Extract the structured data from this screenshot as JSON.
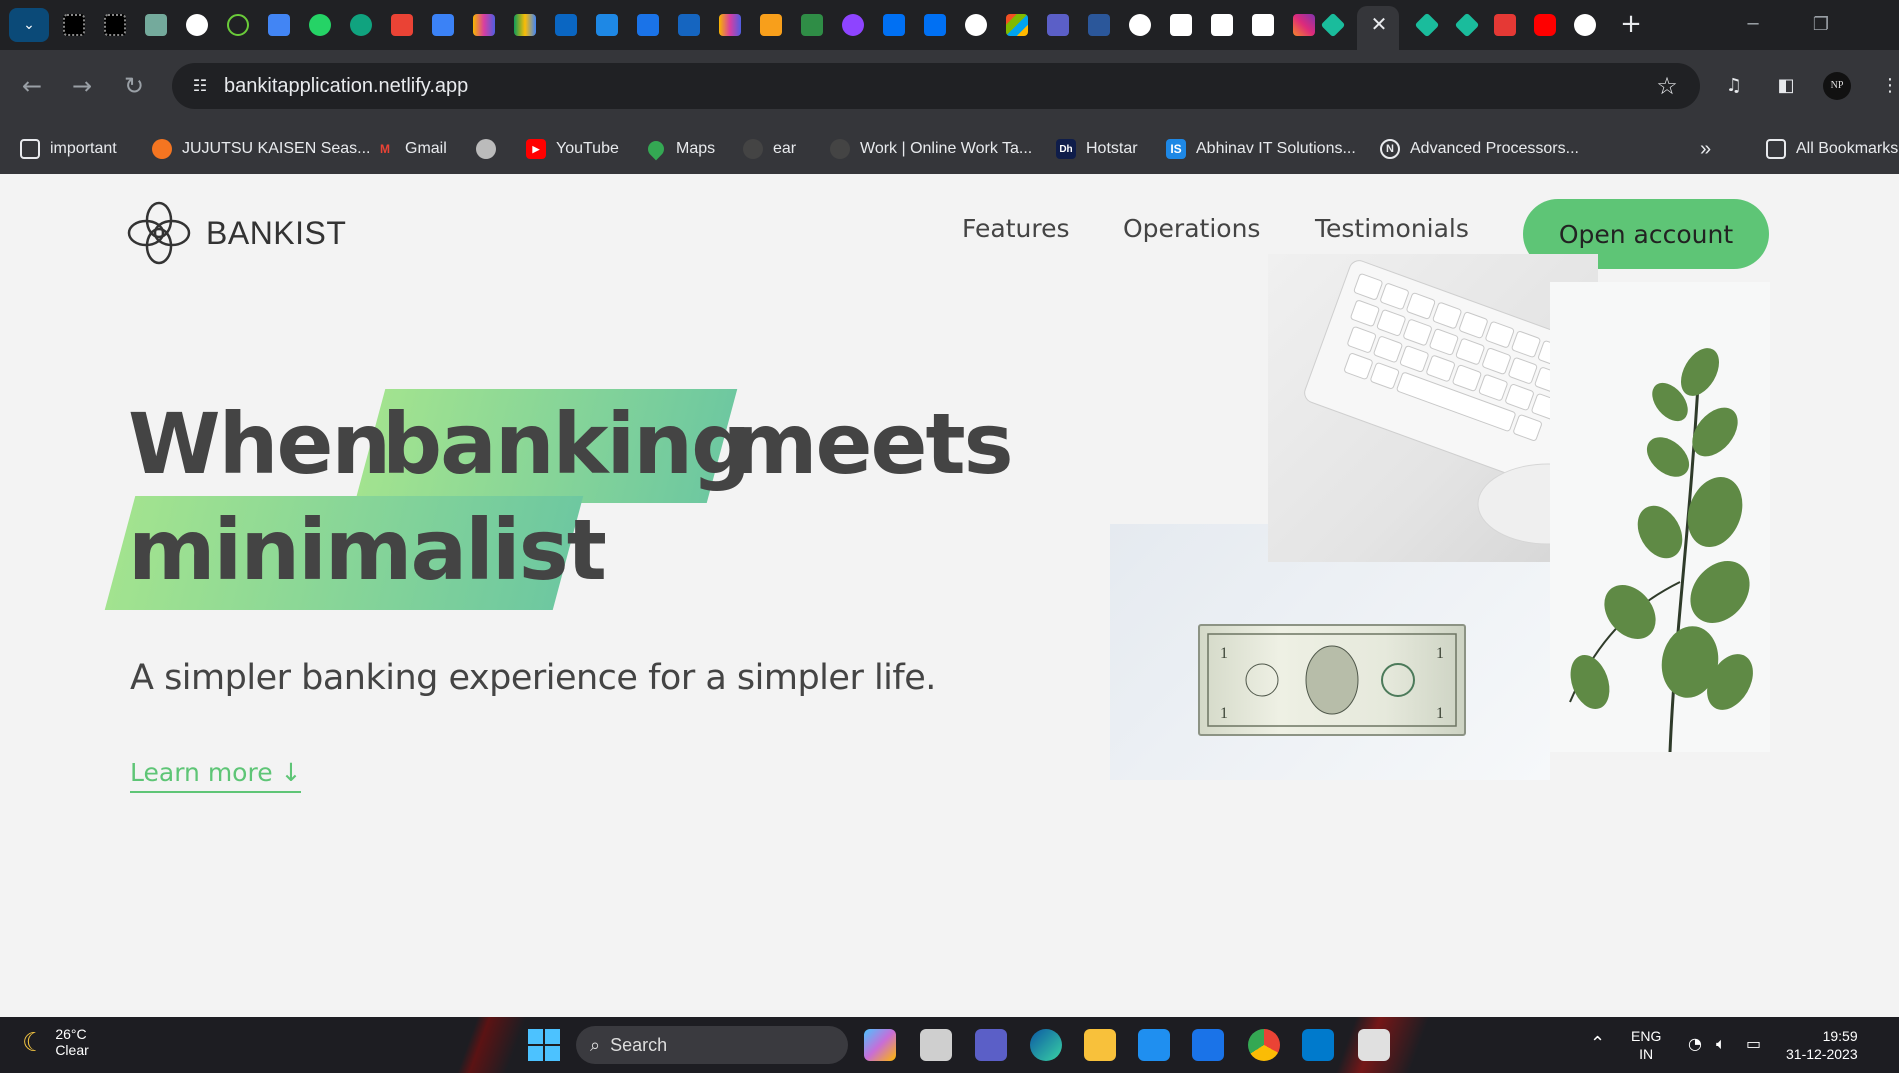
{
  "browser": {
    "url": "bankitapplication.netlify.app",
    "active_tab_close": "✕",
    "new_tab": "+",
    "bookmarks": [
      {
        "label": "important",
        "icon": "folder-icon"
      },
      {
        "label": "JUJUTSU KAISEN Seas...",
        "icon": "crunchyroll-icon"
      },
      {
        "label": "Gmail",
        "icon": "gmail-icon"
      },
      {
        "label": "",
        "icon": "globe-icon"
      },
      {
        "label": "YouTube",
        "icon": "youtube-icon"
      },
      {
        "label": "Maps",
        "icon": "maps-icon"
      },
      {
        "label": "ear",
        "icon": "person-icon"
      },
      {
        "label": "Work | Online Work Ta...",
        "icon": "person-icon"
      },
      {
        "label": "Hotstar",
        "icon": "hotstar-icon"
      },
      {
        "label": "Abhinav IT Solutions...",
        "icon": "is-icon"
      },
      {
        "label": "Advanced Processors...",
        "icon": "n-icon"
      }
    ],
    "all_bookmarks": "All Bookmarks",
    "profile_initials": "NP"
  },
  "site": {
    "logo_text": "BANKIST",
    "nav": [
      "Features",
      "Operations",
      "Testimonials"
    ],
    "cta": "Open account",
    "hero": {
      "word_when": "When",
      "word_banking": "banking",
      "word_meets": "meets",
      "word_minimalist": "minimalist",
      "subtitle": "A simpler banking experience for a simpler life.",
      "learn_more": "Learn more ↓"
    }
  },
  "taskbar": {
    "weather_temp": "26°C",
    "weather_cond": "Clear",
    "search_label": "Search",
    "lang_line1": "ENG",
    "lang_line2": "IN",
    "time": "19:59",
    "date": "31-12-2023"
  },
  "colors": {
    "accent_green": "#5ec576",
    "highlight_start": "#a2e38f",
    "highlight_end": "#6ec8a0"
  }
}
